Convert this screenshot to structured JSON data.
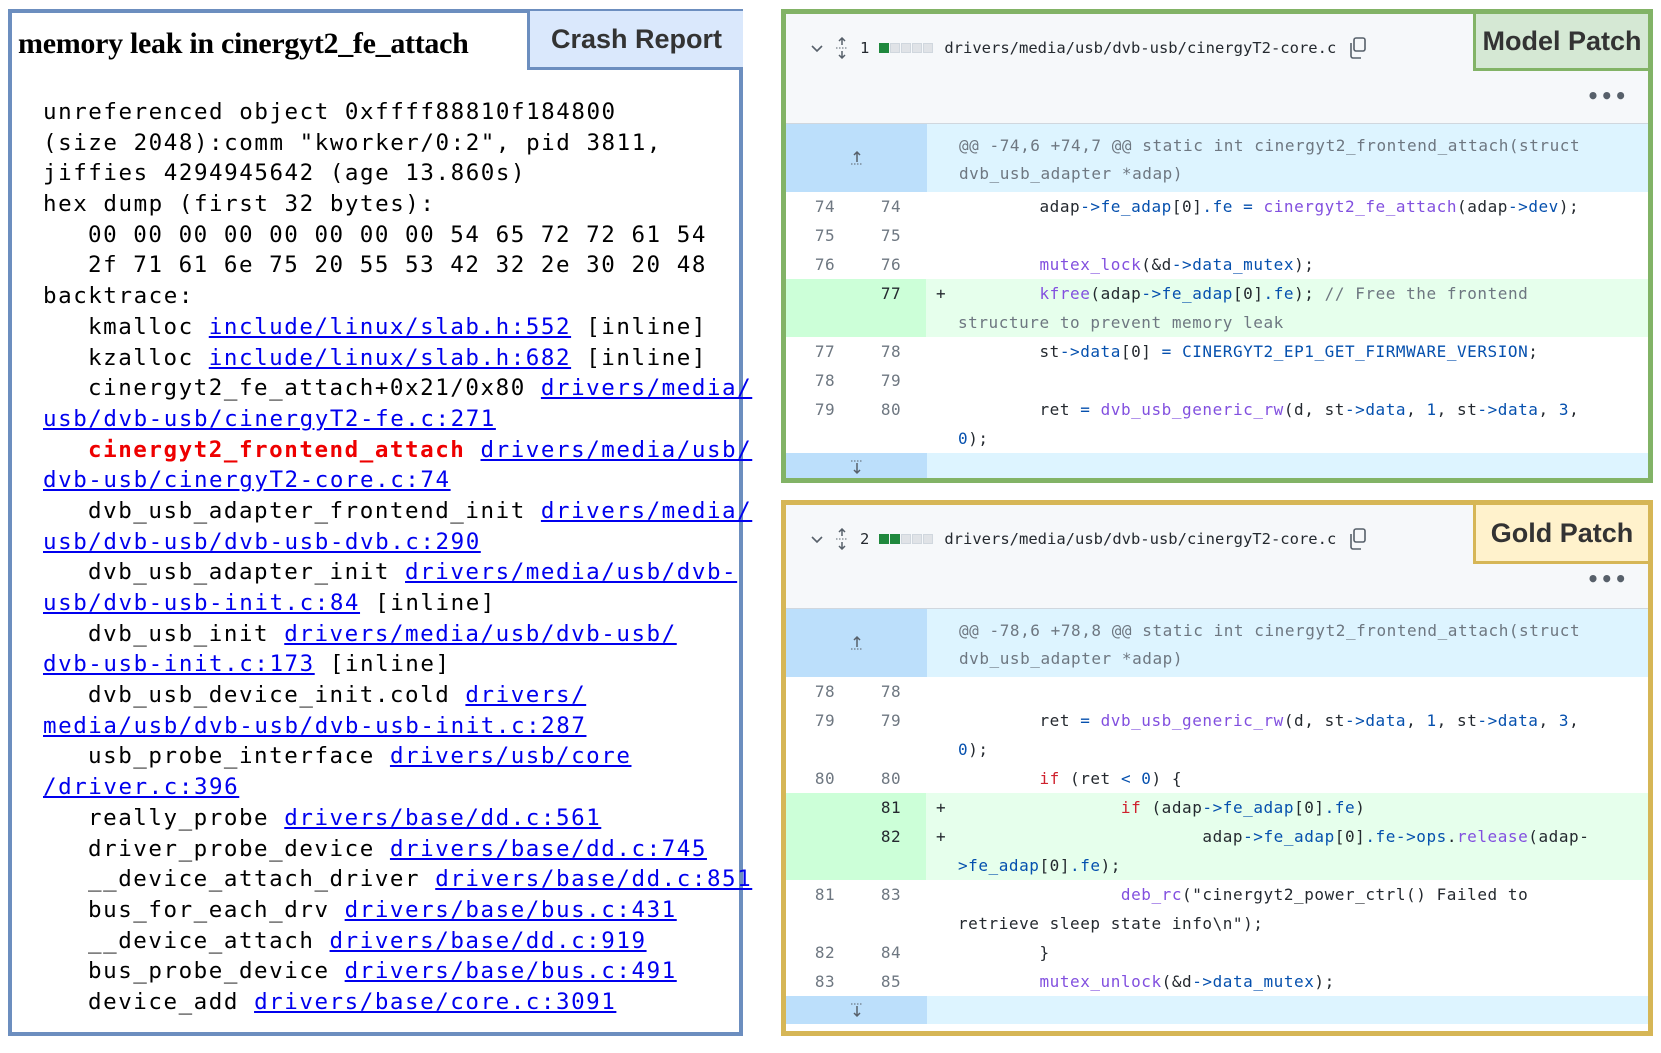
{
  "crash_report": {
    "title": "memory leak in cinergyt2_fe_attach",
    "tab_label": "Crash Report",
    "lines": [
      {
        "ind": false,
        "segs": [
          {
            "t": "unreferenced object 0xffff88810f184800",
            "k": "plain"
          }
        ]
      },
      {
        "ind": false,
        "segs": [
          {
            "t": "(size 2048):comm \"kworker/0:2\", pid 3811,",
            "k": "plain"
          }
        ]
      },
      {
        "ind": false,
        "segs": [
          {
            "t": "jiffies 4294945642 (age 13.860s)",
            "k": "plain"
          }
        ]
      },
      {
        "ind": false,
        "segs": [
          {
            "t": "hex dump (first 32 bytes):",
            "k": "plain"
          }
        ]
      },
      {
        "ind": true,
        "segs": [
          {
            "t": "00 00 00 00 00 00 00 00 54 65 72 72 61 54",
            "k": "plain"
          }
        ]
      },
      {
        "ind": true,
        "segs": [
          {
            "t": "2f 71 61 6e 75 20 55 53 42 32 2e 30 20 48",
            "k": "plain"
          }
        ]
      },
      {
        "ind": false,
        "segs": [
          {
            "t": "backtrace:",
            "k": "plain"
          }
        ]
      },
      {
        "ind": true,
        "segs": [
          {
            "t": "kmalloc ",
            "k": "plain"
          },
          {
            "t": "include/linux/slab.h:552",
            "k": "link"
          },
          {
            "t": " [inline]",
            "k": "plain"
          }
        ]
      },
      {
        "ind": true,
        "segs": [
          {
            "t": "kzalloc ",
            "k": "plain"
          },
          {
            "t": "include/linux/slab.h:682",
            "k": "link"
          },
          {
            "t": " [inline]",
            "k": "plain"
          }
        ]
      },
      {
        "ind": true,
        "segs": [
          {
            "t": "cinergyt2_fe_attach+0x21/0x80 ",
            "k": "plain"
          },
          {
            "t": "drivers/media/",
            "k": "link"
          }
        ]
      },
      {
        "ind": false,
        "segs": [
          {
            "t": "usb/dvb-usb/cinergyT2-fe.c:271",
            "k": "link"
          }
        ]
      },
      {
        "ind": true,
        "segs": [
          {
            "t": "cinergyt2_frontend_attach",
            "k": "red"
          },
          {
            "t": " ",
            "k": "plain"
          },
          {
            "t": "drivers/media/usb/",
            "k": "link"
          }
        ]
      },
      {
        "ind": false,
        "segs": [
          {
            "t": "dvb-usb/cinergyT2-core.c:74",
            "k": "link"
          }
        ]
      },
      {
        "ind": true,
        "segs": [
          {
            "t": "dvb_usb_adapter_frontend_init ",
            "k": "plain"
          },
          {
            "t": "drivers/media/",
            "k": "link"
          }
        ]
      },
      {
        "ind": false,
        "segs": [
          {
            "t": "usb/dvb-usb/dvb-usb-dvb.c:290",
            "k": "link"
          }
        ]
      },
      {
        "ind": true,
        "segs": [
          {
            "t": "dvb_usb_adapter_init ",
            "k": "plain"
          },
          {
            "t": "drivers/media/usb/dvb-",
            "k": "link"
          }
        ]
      },
      {
        "ind": false,
        "segs": [
          {
            "t": "usb/dvb-usb-init.c:84",
            "k": "link"
          },
          {
            "t": " [inline]",
            "k": "plain"
          }
        ]
      },
      {
        "ind": true,
        "segs": [
          {
            "t": "dvb_usb_init ",
            "k": "plain"
          },
          {
            "t": "drivers/media/usb/dvb-usb/",
            "k": "link"
          }
        ]
      },
      {
        "ind": false,
        "segs": [
          {
            "t": "dvb-usb-init.c:173",
            "k": "link"
          },
          {
            "t": " [inline]",
            "k": "plain"
          }
        ]
      },
      {
        "ind": true,
        "segs": [
          {
            "t": "dvb_usb_device_init.cold ",
            "k": "plain"
          },
          {
            "t": "drivers/",
            "k": "link"
          }
        ]
      },
      {
        "ind": false,
        "segs": [
          {
            "t": "media/usb/dvb-usb/dvb-usb-init.c:287",
            "k": "link"
          }
        ]
      },
      {
        "ind": true,
        "segs": [
          {
            "t": "usb_probe_interface ",
            "k": "plain"
          },
          {
            "t": "drivers/usb/core",
            "k": "link"
          }
        ]
      },
      {
        "ind": false,
        "segs": [
          {
            "t": "/driver.c:396",
            "k": "link"
          }
        ]
      },
      {
        "ind": true,
        "segs": [
          {
            "t": "really_probe ",
            "k": "plain"
          },
          {
            "t": "drivers/base/dd.c:561",
            "k": "link"
          }
        ]
      },
      {
        "ind": true,
        "segs": [
          {
            "t": "driver_probe_device ",
            "k": "plain"
          },
          {
            "t": "drivers/base/dd.c:745",
            "k": "link"
          }
        ]
      },
      {
        "ind": true,
        "segs": [
          {
            "t": "__device_attach_driver ",
            "k": "plain"
          },
          {
            "t": "drivers/base/dd.c:851",
            "k": "link"
          }
        ]
      },
      {
        "ind": true,
        "segs": [
          {
            "t": "bus_for_each_drv ",
            "k": "plain"
          },
          {
            "t": "drivers/base/bus.c:431",
            "k": "link"
          }
        ]
      },
      {
        "ind": true,
        "segs": [
          {
            "t": "__device_attach ",
            "k": "plain"
          },
          {
            "t": "drivers/base/dd.c:919",
            "k": "link"
          }
        ]
      },
      {
        "ind": true,
        "segs": [
          {
            "t": "bus_probe_device ",
            "k": "plain"
          },
          {
            "t": "drivers/base/bus.c:491",
            "k": "link"
          }
        ]
      },
      {
        "ind": true,
        "segs": [
          {
            "t": "device_add ",
            "k": "plain"
          },
          {
            "t": "drivers/base/core.c:3091",
            "k": "link"
          }
        ]
      }
    ],
    "colors": {
      "border": "#6c8ebf",
      "tab_bg": "#dae8fc",
      "link": "#0000ee",
      "highlight": "#ee0000"
    }
  },
  "patches": [
    {
      "id": "model",
      "label": "Model Patch",
      "file_index": "1",
      "filename": "drivers/media/usb/dvb-usb/cinergyT2-core.c",
      "diffstat": {
        "added_blocks": 1,
        "total_blocks": 5
      },
      "kebab": "•••",
      "hunk_header": [
        "@@ -74,6 +74,7 @@ static int cinergyt2_frontend_attach(struct",
        "dvb_usb_adapter *adap)"
      ],
      "rows": [
        {
          "old": "74",
          "new": "74",
          "sign": "",
          "type": "ctx",
          "lines": [
            [
              [
                "        adap",
                "d"
              ],
              [
                "->fe_adap",
                "b"
              ],
              [
                "[0]",
                "d"
              ],
              [
                ".fe",
                "b"
              ],
              [
                " = ",
                "b"
              ],
              [
                "cinergyt2_fe_attach",
                "p"
              ],
              [
                "(adap",
                "d"
              ],
              [
                "->dev",
                "b"
              ],
              [
                ");",
                "d"
              ]
            ]
          ]
        },
        {
          "old": "75",
          "new": "75",
          "sign": "",
          "type": "ctx",
          "lines": [
            [
              [
                " ",
                "d"
              ]
            ]
          ]
        },
        {
          "old": "76",
          "new": "76",
          "sign": "",
          "type": "ctx",
          "lines": [
            [
              [
                "        mutex_lock",
                "p"
              ],
              [
                "(&d",
                "d"
              ],
              [
                "->data_mutex",
                "b"
              ],
              [
                ");",
                "d"
              ]
            ]
          ]
        },
        {
          "old": "",
          "new": "77",
          "sign": "+",
          "type": "add",
          "lines": [
            [
              [
                "        kfree",
                "p"
              ],
              [
                "(adap",
                "d"
              ],
              [
                "->fe_adap",
                "b"
              ],
              [
                "[0]",
                "d"
              ],
              [
                ".fe",
                "b"
              ],
              [
                "); ",
                "d"
              ],
              [
                "// Free the frontend",
                "g"
              ]
            ],
            [
              [
                "structure to prevent memory leak",
                "g"
              ]
            ]
          ]
        },
        {
          "old": "77",
          "new": "78",
          "sign": "",
          "type": "ctx",
          "lines": [
            [
              [
                "        st",
                "d"
              ],
              [
                "->data",
                "b"
              ],
              [
                "[0]",
                "d"
              ],
              [
                " = ",
                "b"
              ],
              [
                "CINERGYT2_EP1_GET_FIRMWARE_VERSION",
                "b"
              ],
              [
                ";",
                "d"
              ]
            ]
          ]
        },
        {
          "old": "78",
          "new": "79",
          "sign": "",
          "type": "ctx",
          "lines": [
            [
              [
                " ",
                "d"
              ]
            ]
          ]
        },
        {
          "old": "79",
          "new": "80",
          "sign": "",
          "type": "ctx",
          "lines": [
            [
              [
                "        ret",
                "d"
              ],
              [
                " = ",
                "b"
              ],
              [
                "dvb_usb_generic_rw",
                "p"
              ],
              [
                "(d, st",
                "d"
              ],
              [
                "->data",
                "b"
              ],
              [
                ", ",
                "d"
              ],
              [
                "1",
                "b"
              ],
              [
                ", st",
                "d"
              ],
              [
                "->data",
                "b"
              ],
              [
                ", ",
                "d"
              ],
              [
                "3",
                "b"
              ],
              [
                ",",
                "d"
              ]
            ],
            [
              [
                "0",
                "b"
              ],
              [
                ");",
                "d"
              ]
            ]
          ]
        }
      ],
      "colors": {
        "border": "#82b366",
        "label_bg": "#d5e8d4"
      }
    },
    {
      "id": "gold",
      "label": "Gold Patch",
      "file_index": "2",
      "filename": "drivers/media/usb/dvb-usb/cinergyT2-core.c",
      "diffstat": {
        "added_blocks": 2,
        "total_blocks": 5
      },
      "kebab": "•••",
      "hunk_header": [
        "@@ -78,6 +78,8 @@ static int cinergyt2_frontend_attach(struct",
        "dvb_usb_adapter *adap)"
      ],
      "rows": [
        {
          "old": "78",
          "new": "78",
          "sign": "",
          "type": "ctx",
          "lines": [
            [
              [
                " ",
                "d"
              ]
            ]
          ]
        },
        {
          "old": "79",
          "new": "79",
          "sign": "",
          "type": "ctx",
          "lines": [
            [
              [
                "        ret",
                "d"
              ],
              [
                " = ",
                "b"
              ],
              [
                "dvb_usb_generic_rw",
                "p"
              ],
              [
                "(d, st",
                "d"
              ],
              [
                "->data",
                "b"
              ],
              [
                ", ",
                "d"
              ],
              [
                "1",
                "b"
              ],
              [
                ", st",
                "d"
              ],
              [
                "->data",
                "b"
              ],
              [
                ", ",
                "d"
              ],
              [
                "3",
                "b"
              ],
              [
                ",",
                "d"
              ]
            ],
            [
              [
                "0",
                "b"
              ],
              [
                ");",
                "d"
              ]
            ]
          ]
        },
        {
          "old": "80",
          "new": "80",
          "sign": "",
          "type": "ctx",
          "lines": [
            [
              [
                "        if",
                "r"
              ],
              [
                " (ret ",
                "d"
              ],
              [
                "<",
                "b"
              ],
              [
                " 0",
                "b"
              ],
              [
                ") {",
                "d"
              ]
            ]
          ]
        },
        {
          "old": "",
          "new": "81",
          "sign": "+",
          "type": "add",
          "lines": [
            [
              [
                "                if",
                "r"
              ],
              [
                " (adap",
                "d"
              ],
              [
                "->fe_adap",
                "b"
              ],
              [
                "[0]",
                "d"
              ],
              [
                ".fe",
                "b"
              ],
              [
                ")",
                "d"
              ]
            ]
          ]
        },
        {
          "old": "",
          "new": "82",
          "sign": "+",
          "type": "add",
          "lines": [
            [
              [
                "                        adap",
                "d"
              ],
              [
                "->fe_adap",
                "b"
              ],
              [
                "[0]",
                "d"
              ],
              [
                ".fe->ops",
                "b"
              ],
              [
                ".",
                "d"
              ],
              [
                "release",
                "p"
              ],
              [
                "(adap-",
                "d"
              ]
            ],
            [
              [
                ">fe_adap",
                "b"
              ],
              [
                "[0]",
                "d"
              ],
              [
                ".fe",
                "b"
              ],
              [
                ");",
                "d"
              ]
            ]
          ]
        },
        {
          "old": "81",
          "new": "83",
          "sign": "",
          "type": "ctx",
          "lines": [
            [
              [
                "                deb_rc",
                "p"
              ],
              [
                "(\"cinergyt2_power_ctrl() Failed to",
                "d"
              ]
            ],
            [
              [
                "retrieve sleep state info\\n\");",
                "d"
              ]
            ]
          ]
        },
        {
          "old": "82",
          "new": "84",
          "sign": "",
          "type": "ctx",
          "lines": [
            [
              [
                "        }",
                "d"
              ]
            ]
          ]
        },
        {
          "old": "83",
          "new": "85",
          "sign": "",
          "type": "ctx",
          "lines": [
            [
              [
                "        mutex_unlock",
                "p"
              ],
              [
                "(&d",
                "d"
              ],
              [
                "->data_mutex",
                "b"
              ],
              [
                ");",
                "d"
              ]
            ]
          ]
        }
      ],
      "colors": {
        "border": "#d6b656",
        "label_bg": "#fff2cc"
      }
    }
  ]
}
